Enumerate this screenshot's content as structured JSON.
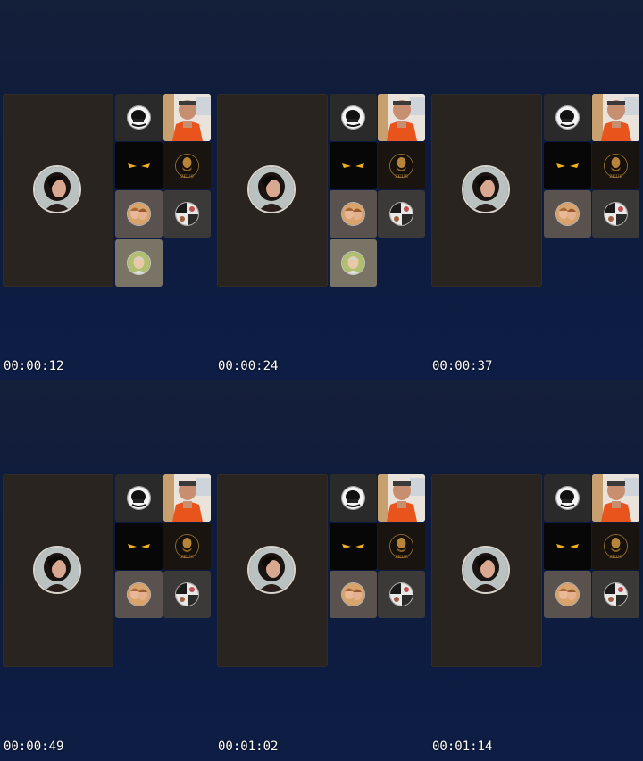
{
  "frames": [
    {
      "timestamp": "00:00:12",
      "participant_count": 8
    },
    {
      "timestamp": "00:00:24",
      "participant_count": 8
    },
    {
      "timestamp": "00:00:37",
      "participant_count": 7
    },
    {
      "timestamp": "00:00:49",
      "participant_count": 7
    },
    {
      "timestamp": "00:01:02",
      "participant_count": 7
    },
    {
      "timestamp": "00:01:14",
      "participant_count": 7
    }
  ],
  "tiles": {
    "main": {
      "icon": "woman-portrait-avatar"
    },
    "helmet": {
      "icon": "helmet-logo-avatar",
      "bg": "#2a2a2a"
    },
    "camera_man": {
      "icon": "man-orange-shirt-video",
      "bg": "#f0e8e0"
    },
    "eyes": {
      "icon": "glowing-eyes-avatar",
      "bg": "#0a0a0a"
    },
    "zeus": {
      "icon": "zeus-logo-avatar",
      "bg": "#1a1410",
      "label": "ZEUS"
    },
    "two_women": {
      "icon": "two-women-avatar",
      "bg": "#5a524e"
    },
    "collage": {
      "icon": "collage-avatar",
      "bg": "#3c3a38"
    },
    "child": {
      "icon": "child-avatar",
      "bg": "#7a7466"
    }
  }
}
